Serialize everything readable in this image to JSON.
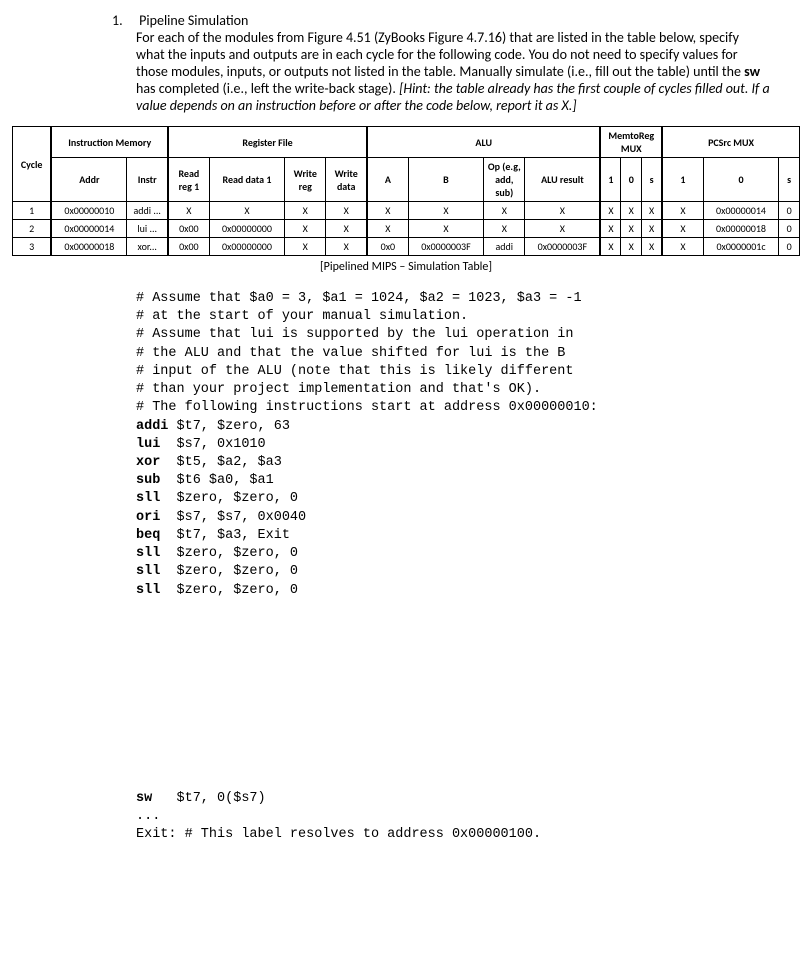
{
  "question": {
    "number": "1.",
    "title": "Pipeline Simulation",
    "body_html": "For each of the modules from Figure 4.51 (ZyBooks Figure 4.7.16) that are listed in the table below, specify what the inputs and outputs are in each cycle for the following code. You do not need to specify values for those modules, inputs, or outputs not listed in the table. Manually simulate (i.e., fill out the table) until the <b>sw</b> has completed (i.e., left the write-back stage). <i>[Hint: the table already has the first couple of cycles filled out. If a value depends on an instruction before or after the code below, report it as X.]</i>"
  },
  "table": {
    "group_headers": [
      "",
      "Instruction Memory",
      "Register File",
      "ALU",
      "MemtoReg MUX",
      "PCSrc MUX"
    ],
    "col_headers": [
      "Cycle",
      "Addr",
      "Instr",
      "Read reg 1",
      "Read data 1",
      "Write reg",
      "Write data",
      "A",
      "B",
      "Op (e.g, add, sub)",
      "ALU result",
      "1",
      "0",
      "s",
      "1",
      "0",
      "s"
    ],
    "rows": [
      {
        "cycle": "1",
        "cells": [
          "0x00000010",
          "addi ...",
          "X",
          "X",
          "X",
          "X",
          "X",
          "X",
          "X",
          "X",
          "X",
          "X",
          "X",
          "X",
          "0x00000014",
          "0"
        ]
      },
      {
        "cycle": "2",
        "cells": [
          "0x00000014",
          "lui ...",
          "0x00",
          "0x00000000",
          "X",
          "X",
          "X",
          "X",
          "X",
          "X",
          "X",
          "X",
          "X",
          "X",
          "0x00000018",
          "0"
        ]
      },
      {
        "cycle": "3",
        "cells": [
          "0x00000018",
          "xor...",
          "0x00",
          "0x00000000",
          "X",
          "X",
          "0x0",
          "0x0000003F",
          "addi",
          "0x0000003F",
          "X",
          "X",
          "X",
          "X",
          "0x0000001c",
          "0"
        ]
      }
    ],
    "caption": "[Pipelined MIPS – Simulation Table]"
  },
  "code": {
    "c1": "# Assume that $a0 = 3, $a1 = 1024, $a2 = 1023, $a3 = -1",
    "c2": "# at the start of your manual simulation.",
    "c3": "# Assume that lui is supported by the lui operation in",
    "c4": "# the ALU and that the value shifted for lui is the B",
    "c5": "# input of the ALU (note that this is likely different",
    "c6": "# than your project implementation and that's OK).",
    "c7": "# The following instructions start at address 0x00000010:",
    "i1_op": "addi",
    "i1_args": " $t7, $zero, 63",
    "i2_op": "lui",
    "i2_args": "  $s7, 0x1010",
    "i3_op": "xor",
    "i3_args": "  $t5, $a2, $a3",
    "i4_op": "sub",
    "i4_args": "  $t6 $a0, $a1",
    "i5_op": "sll",
    "i5_args": "  $zero, $zero, 0",
    "i6_op": "ori",
    "i6_args": "  $s7, $s7, 0x0040",
    "i7_op": "beq",
    "i7_args": "  $t7, $a3, Exit",
    "i8_op": "sll",
    "i8_args": "  $zero, $zero, 0",
    "i9_op": "sll",
    "i9_args": "  $zero, $zero, 0",
    "i10_op": "sll",
    "i10_args": "  $zero, $zero, 0",
    "sw_op": "sw",
    "sw_args": "   $t7, 0($s7)",
    "dots": "...",
    "exit": "Exit: # This label resolves to address 0x00000100."
  }
}
